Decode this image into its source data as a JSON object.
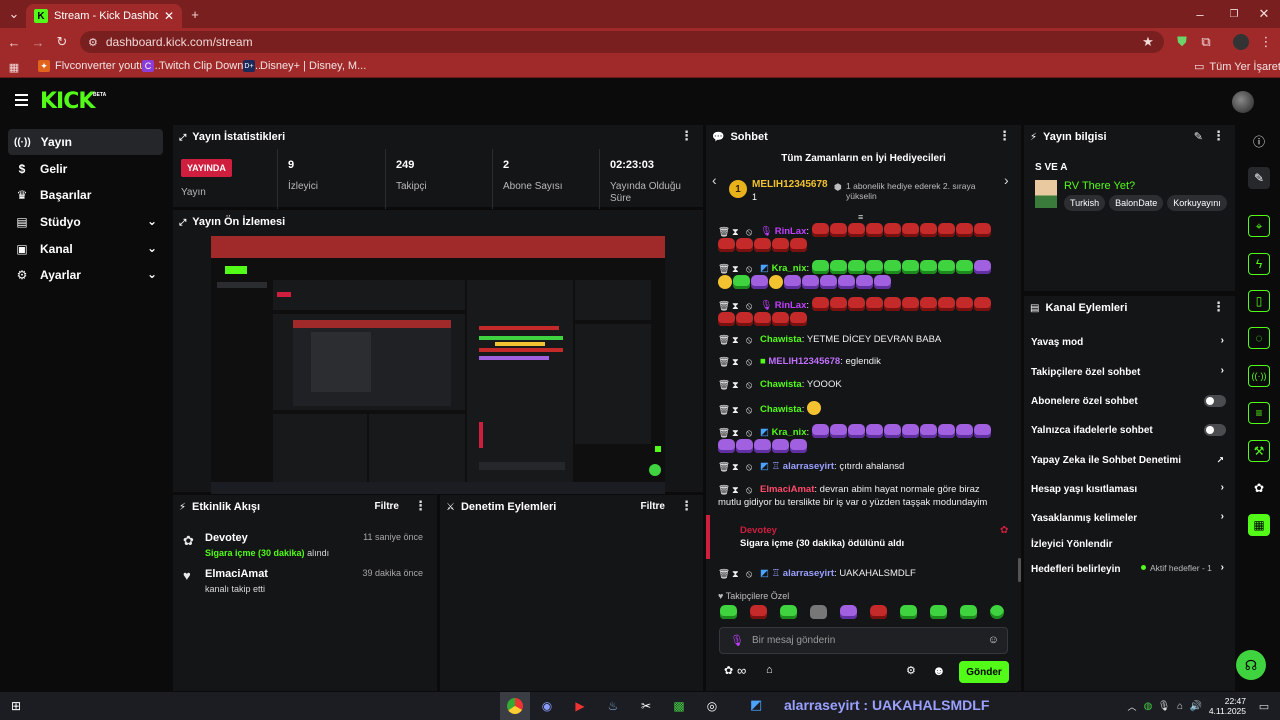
{
  "browser": {
    "tab_title": "Stream - Kick Dashboard",
    "url": "dashboard.kick.com/stream",
    "bookmarks": [
      "Flvconverter youtub...",
      "Twitch Clip Downlo...",
      "Disney+ | Disney, M..."
    ],
    "all_bookmarks": "Tüm Yer İşaretleri"
  },
  "app": {
    "logo": "KICK",
    "beta": "BETA"
  },
  "nav": {
    "items": [
      {
        "label": "Yayın"
      },
      {
        "label": "Gelir"
      },
      {
        "label": "Başarılar"
      },
      {
        "label": "Stüdyo"
      },
      {
        "label": "Kanal"
      },
      {
        "label": "Ayarlar"
      }
    ]
  },
  "stats": {
    "title": "Yayın İstatistikleri",
    "live_badge": "YAYINDA",
    "live_label": "Yayın",
    "viewers_value": "9",
    "viewers_label": "İzleyici",
    "followers_value": "249",
    "followers_label": "Takipçi",
    "subs_value": "2",
    "subs_label": "Abone Sayısı",
    "uptime_value": "02:23:03",
    "uptime_label": "Yayında Olduğu Süre"
  },
  "preview": {
    "title": "Yayın Ön İzlemesi"
  },
  "activity": {
    "title": "Etkinlik Akışı",
    "filter": "Filtre",
    "items": [
      {
        "name": "Devotey",
        "highlight": "Sigara içme (30 dakika)",
        "rest": " alındı",
        "time": "11 saniye önce"
      },
      {
        "name": "ElmaciAmat",
        "highlight": "",
        "rest": "kanalı takip etti",
        "time": "39 dakika önce"
      }
    ]
  },
  "moderation": {
    "title": "Denetim Eylemleri",
    "filter": "Filtre"
  },
  "chat": {
    "title": "Sohbet",
    "top_gifters_title": "Tüm Zamanların en İyi Hediyecileri",
    "top_gifter_rank": "1",
    "top_gifter_name": "MELIH12345678",
    "top_gifter_count": "1",
    "top_gifter_hint": "1 abonelik hediye ederek 2. sıraya yükselin",
    "messages": [
      {
        "user": "RinLax",
        "color": "#c040ff",
        "text": ""
      },
      {
        "user": "Kra_nix",
        "color": "#53fc18",
        "text": ""
      },
      {
        "user": "RinLax",
        "color": "#c040ff",
        "text": ""
      },
      {
        "user": "Chawista",
        "color": "#53fc18",
        "text": "YETME DİCEY DEVRAN BABA"
      },
      {
        "user": "MELIH12345678",
        "color": "#c070ff",
        "text": "eglendik"
      },
      {
        "user": "Chawista",
        "color": "#53fc18",
        "text": "YOOOK"
      },
      {
        "user": "Chawista",
        "color": "#53fc18",
        "text": ""
      },
      {
        "user": "Kra_nix",
        "color": "#53fc18",
        "text": ""
      },
      {
        "user": "alarraseyirt",
        "color": "#9aa0ff",
        "text": "çıtırdı ahalansd"
      },
      {
        "user": "ElmaciAmat",
        "color": "#ff4a6a",
        "text": "devran abim hayat normale göre biraz mutlu gidiyor bu terslikte bir iş var o yüzden taşşak modundayim"
      },
      {
        "user": "alarraseyirt",
        "color": "#9aa0ff",
        "text": "UAKAHALSMDLF"
      }
    ],
    "redeem_user": "Devotey",
    "redeem_text": "Sigara içme (30 dakika) ödülünü aldı",
    "followers_only": "Takipçilere Özel",
    "input_placeholder": "Bir mesaj gönderin",
    "infinity": "∞",
    "send": "Gönder"
  },
  "stream_info": {
    "title": "Yayın bilgisi",
    "stream_title": "S VE A",
    "category": "RV There Yet?",
    "tags": [
      "Turkish",
      "BalonDate",
      "Korkuyayını"
    ]
  },
  "channel_actions": {
    "title": "Kanal Eylemleri",
    "slow_mode": "Yavaş mod",
    "followers_chat": "Takipçilere özel sohbet",
    "subs_chat": "Abonelere özel sohbet",
    "emotes_chat": "Yalnızca ifadelerle sohbet",
    "ai_moderation": "Yapay Zeka ile Sohbet Denetimi",
    "age_restriction": "Hesap yaşı kısıtlaması",
    "banned_words": "Yasaklanmış kelimeler",
    "raid": "İzleyici Yönlendir",
    "goals": "Hedefleri belirleyin",
    "goals_status": "Aktif hedefler - 1"
  },
  "taskbar": {
    "overlay_text": "alarraseyirt : UAKAHALSMDLF",
    "time": "22:47",
    "date": "4.11.2025"
  },
  "colors": {
    "accent": "#53fc18",
    "live": "#d01e3e",
    "browser": "#a02a2a"
  }
}
